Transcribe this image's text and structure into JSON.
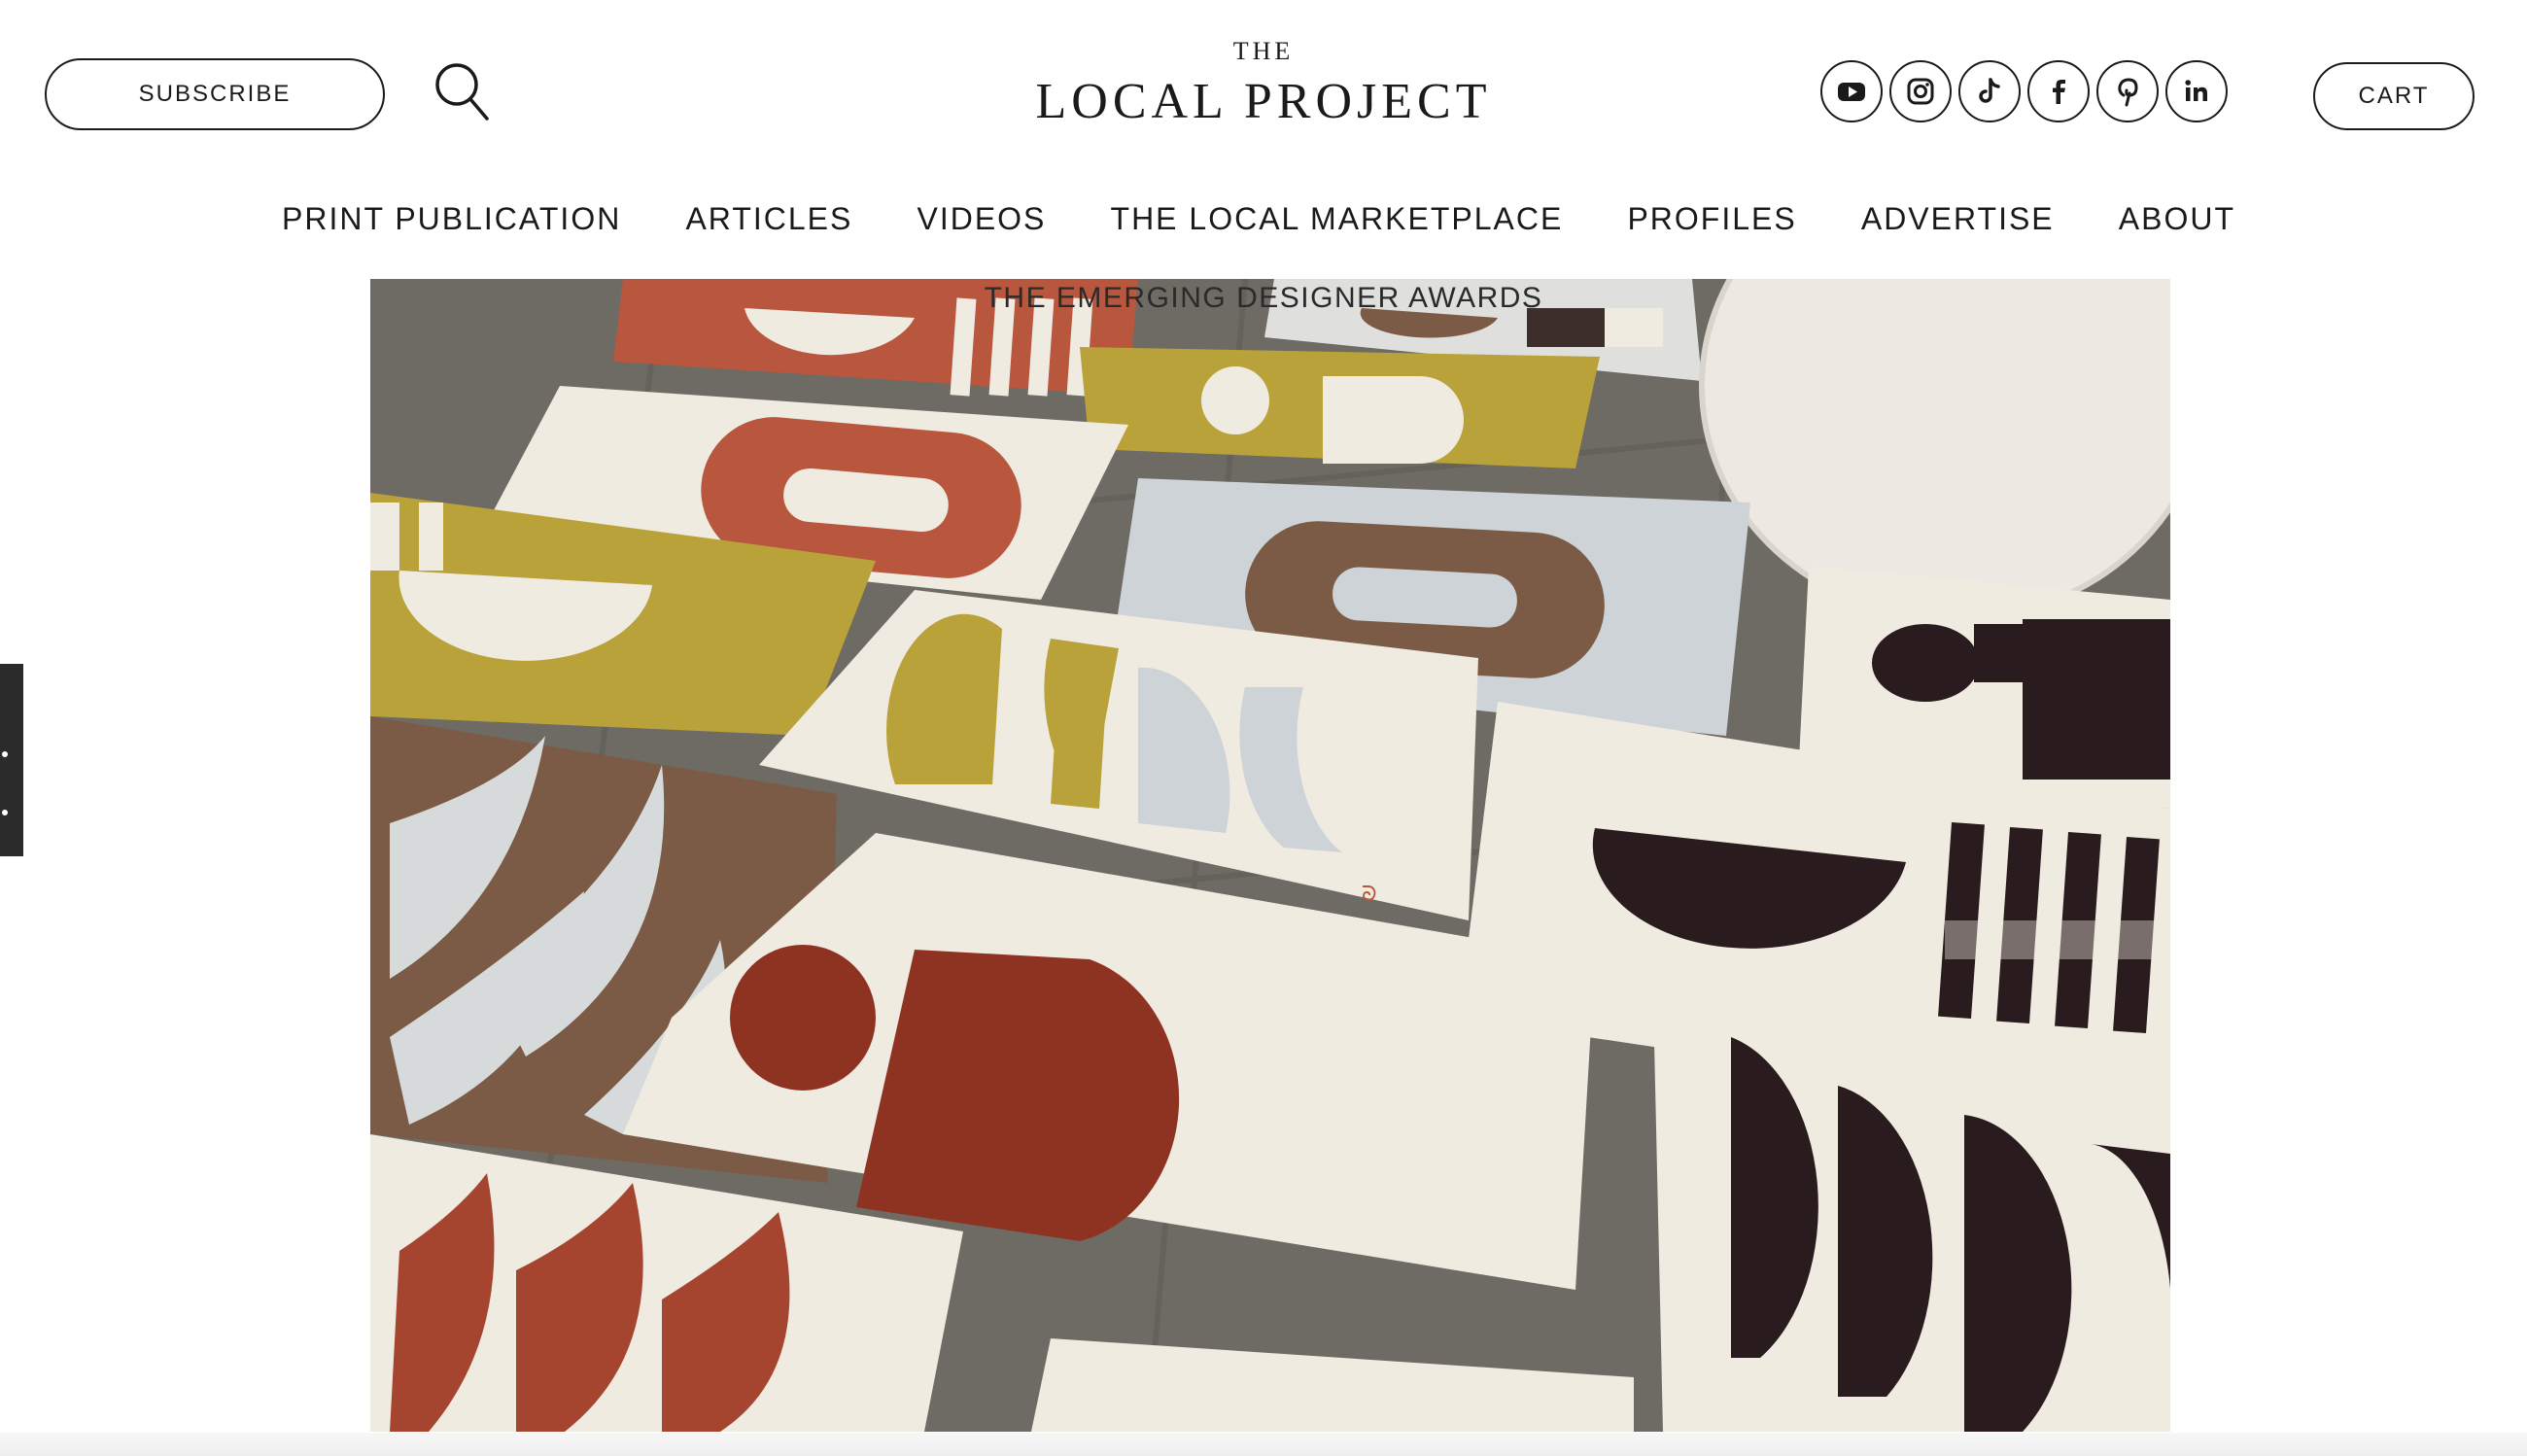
{
  "header": {
    "subscribe_label": "SUBSCRIBE",
    "logo_top": "THE",
    "logo_main": "LOCAL PROJECT",
    "cart_label": "CART",
    "socials": [
      "youtube-icon",
      "instagram-icon",
      "tiktok-icon",
      "facebook-icon",
      "pinterest-icon",
      "linkedin-icon"
    ]
  },
  "nav": {
    "items": [
      {
        "label": "PRINT PUBLICATION"
      },
      {
        "label": "ARTICLES"
      },
      {
        "label": "VIDEOS"
      },
      {
        "label": "THE LOCAL MARKETPLACE"
      },
      {
        "label": "PROFILES"
      },
      {
        "label": "ADVERTISE"
      },
      {
        "label": "ABOUT"
      }
    ]
  },
  "hero": {
    "caption": "THE EMERGING DESIGNER AWARDS"
  },
  "colors": {
    "text": "#1a1a1a",
    "rust": "#b8563e",
    "mustard": "#b9a23a",
    "cream": "#efebe1",
    "pale_blue": "#cdd3d6",
    "brown": "#7b5b45",
    "burgundy": "#8e3222",
    "dark": "#2a1c1e",
    "floor": "#6b6862"
  }
}
